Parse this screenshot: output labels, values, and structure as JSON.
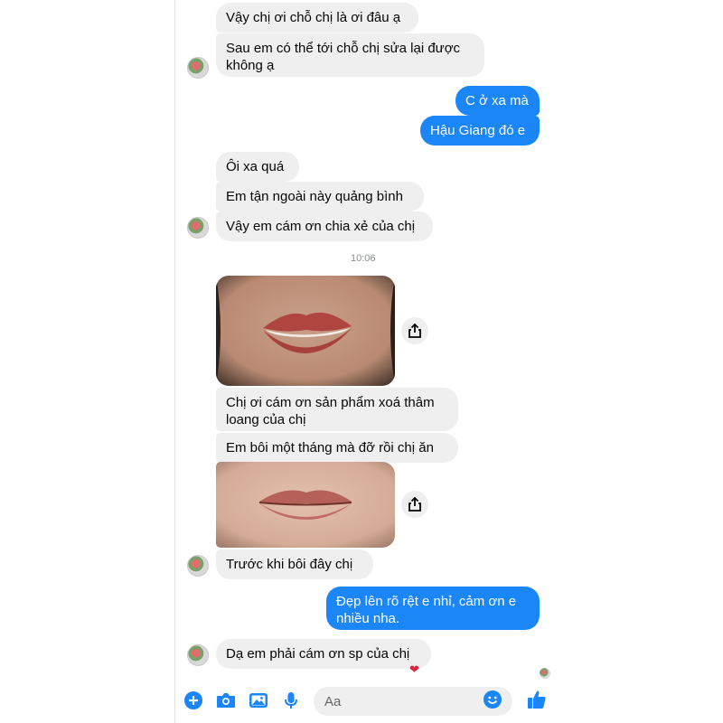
{
  "messages": [
    {
      "text": "Vậy chị ơi chỗ chị là ơi đâu ạ"
    },
    {
      "text": "Sau em có thể tới chỗ chị sửa lại được không ạ"
    },
    {
      "text": "C ở xa mà"
    },
    {
      "text": "Hậu Giang đó e"
    },
    {
      "text": "Ôi xa quá"
    },
    {
      "text": "Em tận ngoài này quảng bình"
    },
    {
      "text": "Vậy em cám ơn chia xẻ của chị"
    },
    {
      "text": "Chị ơi cám ơn sản phẩm xoá thâm loang của chị"
    },
    {
      "text": "Em bôi một tháng mà đỡ rồi chị ăn"
    },
    {
      "text": "Trước  khi bôi đây chị"
    },
    {
      "text": "Đẹp lên rõ rệt e nhỉ, cảm ơn e nhiều nha."
    },
    {
      "text": "Dạ em phải cám ơn sp của chị"
    }
  ],
  "timestamp": "10:06",
  "reaction": "❤",
  "composer": {
    "placeholder": "Aa"
  },
  "colors": {
    "outgoing": "#1a86f7",
    "incoming": "#efefef",
    "icon": "#1a86f7"
  },
  "icons": [
    "plus-icon",
    "camera-icon",
    "gallery-icon",
    "microphone-icon",
    "emoji-icon",
    "thumbs-up-icon",
    "share-icon"
  ]
}
